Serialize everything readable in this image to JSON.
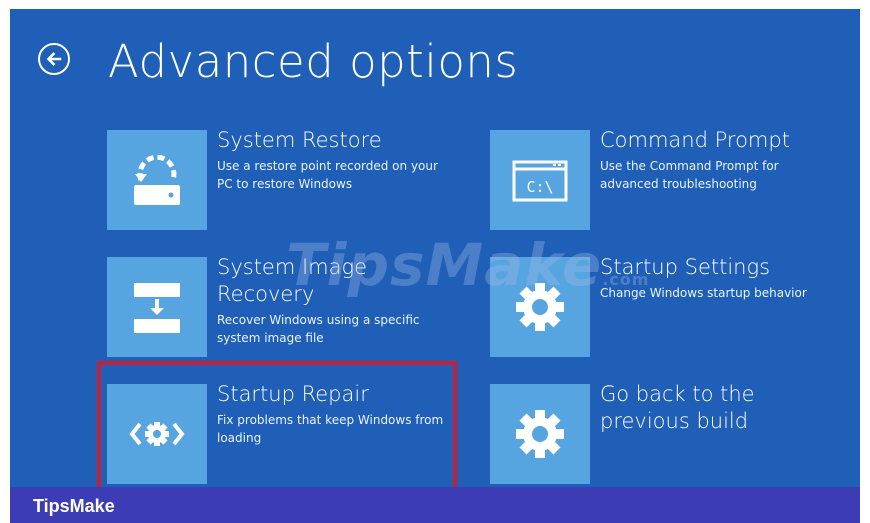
{
  "header": {
    "title": "Advanced options",
    "back_icon": "back-arrow-icon"
  },
  "options": [
    {
      "title": "System Restore",
      "description": "Use a restore point recorded on your PC to restore Windows",
      "icon": "system-restore-icon"
    },
    {
      "title": "Command Prompt",
      "description": "Use the Command Prompt for advanced troubleshooting",
      "icon": "command-prompt-icon"
    },
    {
      "title": "System Image Recovery",
      "description": "Recover Windows using a specific system image file",
      "icon": "system-image-recovery-icon"
    },
    {
      "title": "Startup Settings",
      "description": "Change Windows startup behavior",
      "icon": "gear-icon"
    },
    {
      "title": "Startup Repair",
      "description": "Fix problems that keep Windows from loading",
      "icon": "startup-repair-icon"
    },
    {
      "title": "Go back to the previous build",
      "description": "",
      "icon": "gear-icon"
    }
  ],
  "cmd_glyph": "C:\\",
  "watermark": {
    "main": "TipsMake",
    "suffix": ".com"
  },
  "footer": {
    "brand": "TipsMake"
  },
  "colors": {
    "background": "#1f5fb7",
    "tile": "#56a4e0",
    "highlight": "#c0223b",
    "footer": "#3c3cb4"
  }
}
